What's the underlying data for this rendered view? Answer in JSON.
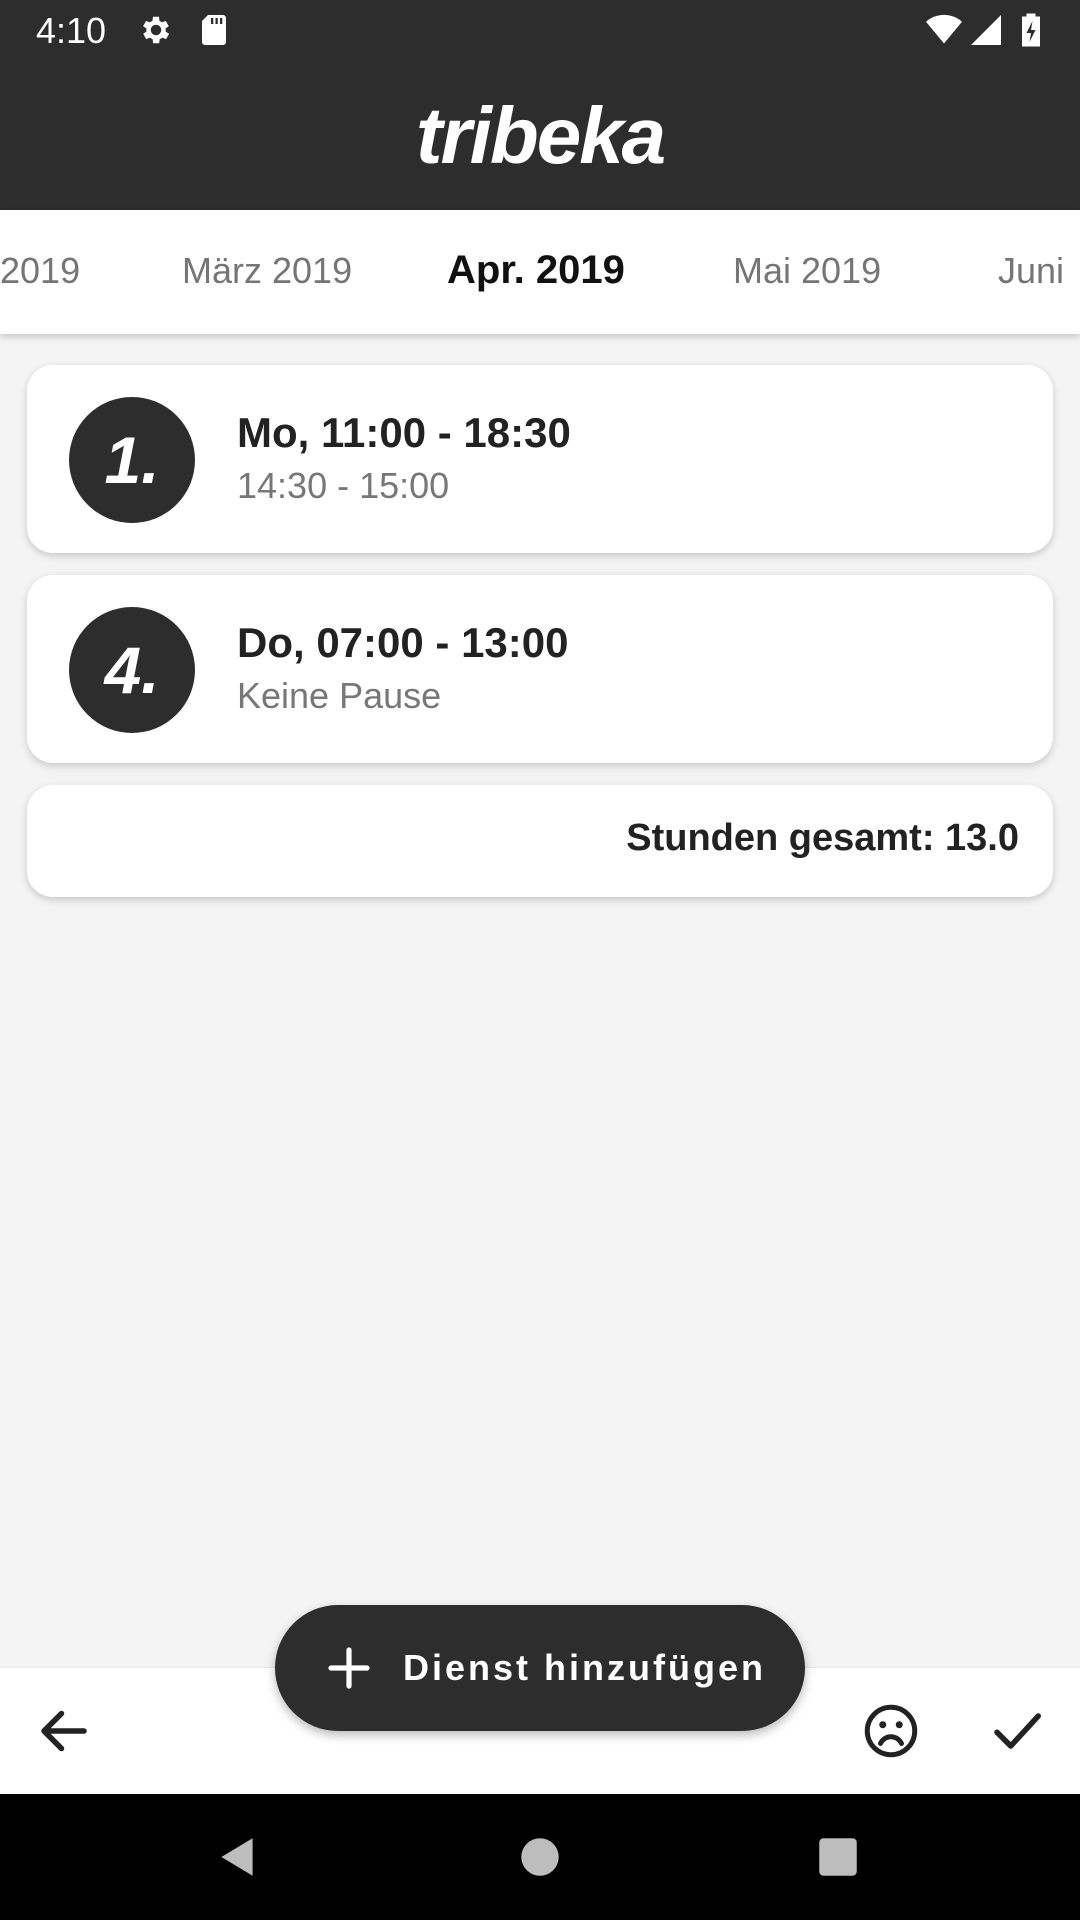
{
  "status_bar": {
    "time": "4:10",
    "left_icons": [
      "gear-icon",
      "sd-card-icon"
    ],
    "right_icons": [
      "wifi-icon",
      "signal-icon",
      "battery-charging-icon"
    ]
  },
  "app_bar": {
    "logo_text": "tribeka"
  },
  "months": {
    "items": [
      "2019",
      "März 2019",
      "Apr. 2019",
      "Mai 2019",
      "Juni"
    ],
    "selected": "Apr. 2019"
  },
  "shifts": [
    {
      "badge": "1.",
      "title": "Mo, 11:00 - 18:30",
      "subtitle": "14:30 - 15:00"
    },
    {
      "badge": "4.",
      "title": "Do, 07:00 - 13:00",
      "subtitle": "Keine Pause"
    }
  ],
  "total": {
    "label": "Stunden gesamt: 13.0"
  },
  "fab": {
    "label": "Dienst hinzufügen",
    "icon": "plus-icon"
  },
  "bottom_bar": {
    "icons": [
      "back-arrow-icon",
      "sad-face-icon",
      "checkmark-icon"
    ]
  },
  "nav_bar": {
    "icons": [
      "nav-back-icon",
      "nav-home-icon",
      "nav-recents-icon"
    ]
  },
  "colors": {
    "dark": "#2d2d2d",
    "background": "#f4f4f4",
    "card": "#ffffff",
    "muted_text": "#777777"
  }
}
